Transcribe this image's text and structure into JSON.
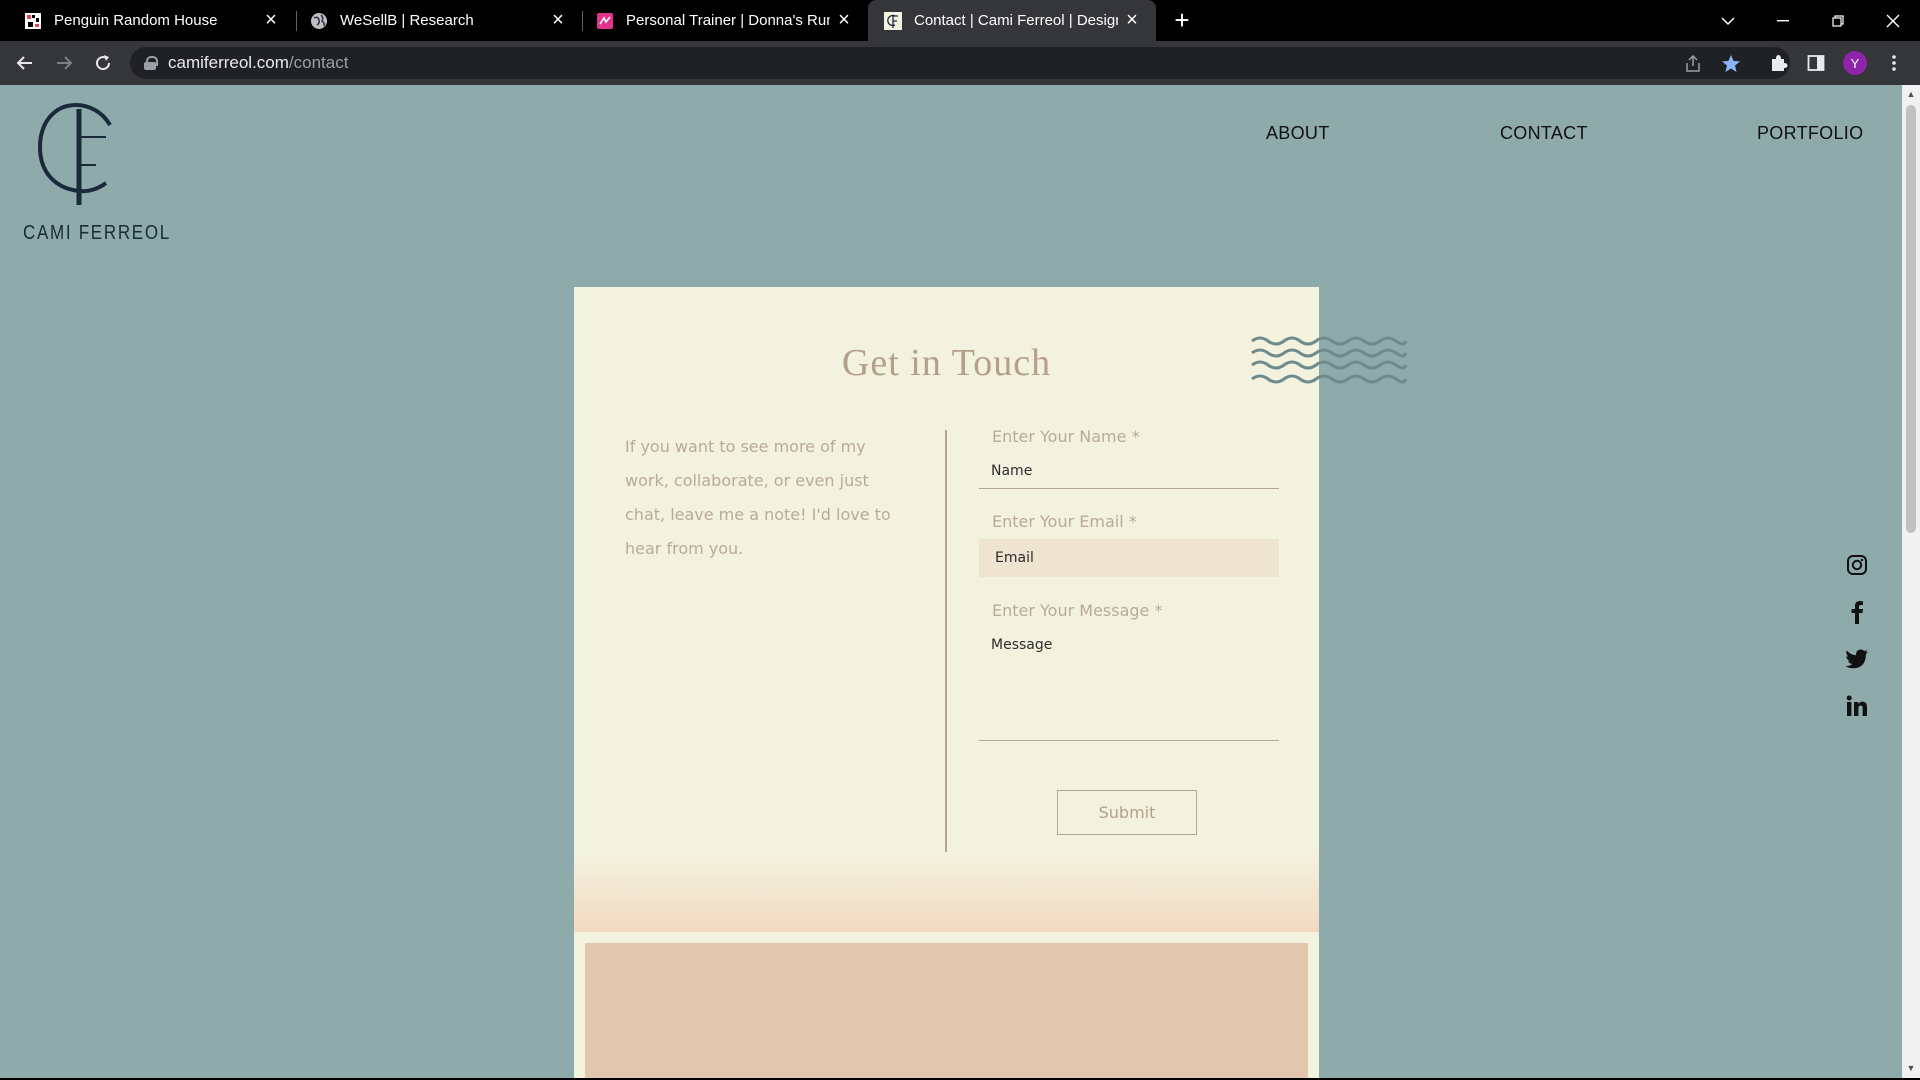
{
  "browser": {
    "tabs": [
      {
        "title": "Penguin Random House",
        "favicon": "penguin-icon",
        "active": false
      },
      {
        "title": "WeSellB | Research",
        "favicon": "globe-icon",
        "active": false
      },
      {
        "title": "Personal Trainer | Donna's Runnir",
        "favicon": "trainer-icon",
        "active": false
      },
      {
        "title": "Contact | Cami Ferreol | Designer",
        "favicon": "cf-logo-icon",
        "active": true
      }
    ],
    "url_host": "camiferreol.com",
    "url_path": "/contact",
    "profile_initial": "Y"
  },
  "site": {
    "brand": "CAMI FERREOL",
    "nav": [
      "ABOUT",
      "CONTACT",
      "PORTFOLIO"
    ],
    "social": [
      "instagram-icon",
      "facebook-icon",
      "twitter-icon",
      "linkedin-icon"
    ]
  },
  "contact": {
    "title": "Get in Touch",
    "intro": "If you want to see more of my work, collaborate, or even just chat, leave me a note! I'd love to hear from you.",
    "name_label": "Enter Your Name *",
    "name_placeholder": "Name",
    "email_label": "Enter Your Email *",
    "email_placeholder": "Email",
    "message_label": "Enter Your Message *",
    "message_placeholder": "Message",
    "submit_label": "Submit"
  },
  "colors": {
    "page_bg": "#8eaaab",
    "card_bg": "#f3f2df",
    "accent_text": "#b4a08a",
    "bottom_block": "#e3c6ae"
  }
}
